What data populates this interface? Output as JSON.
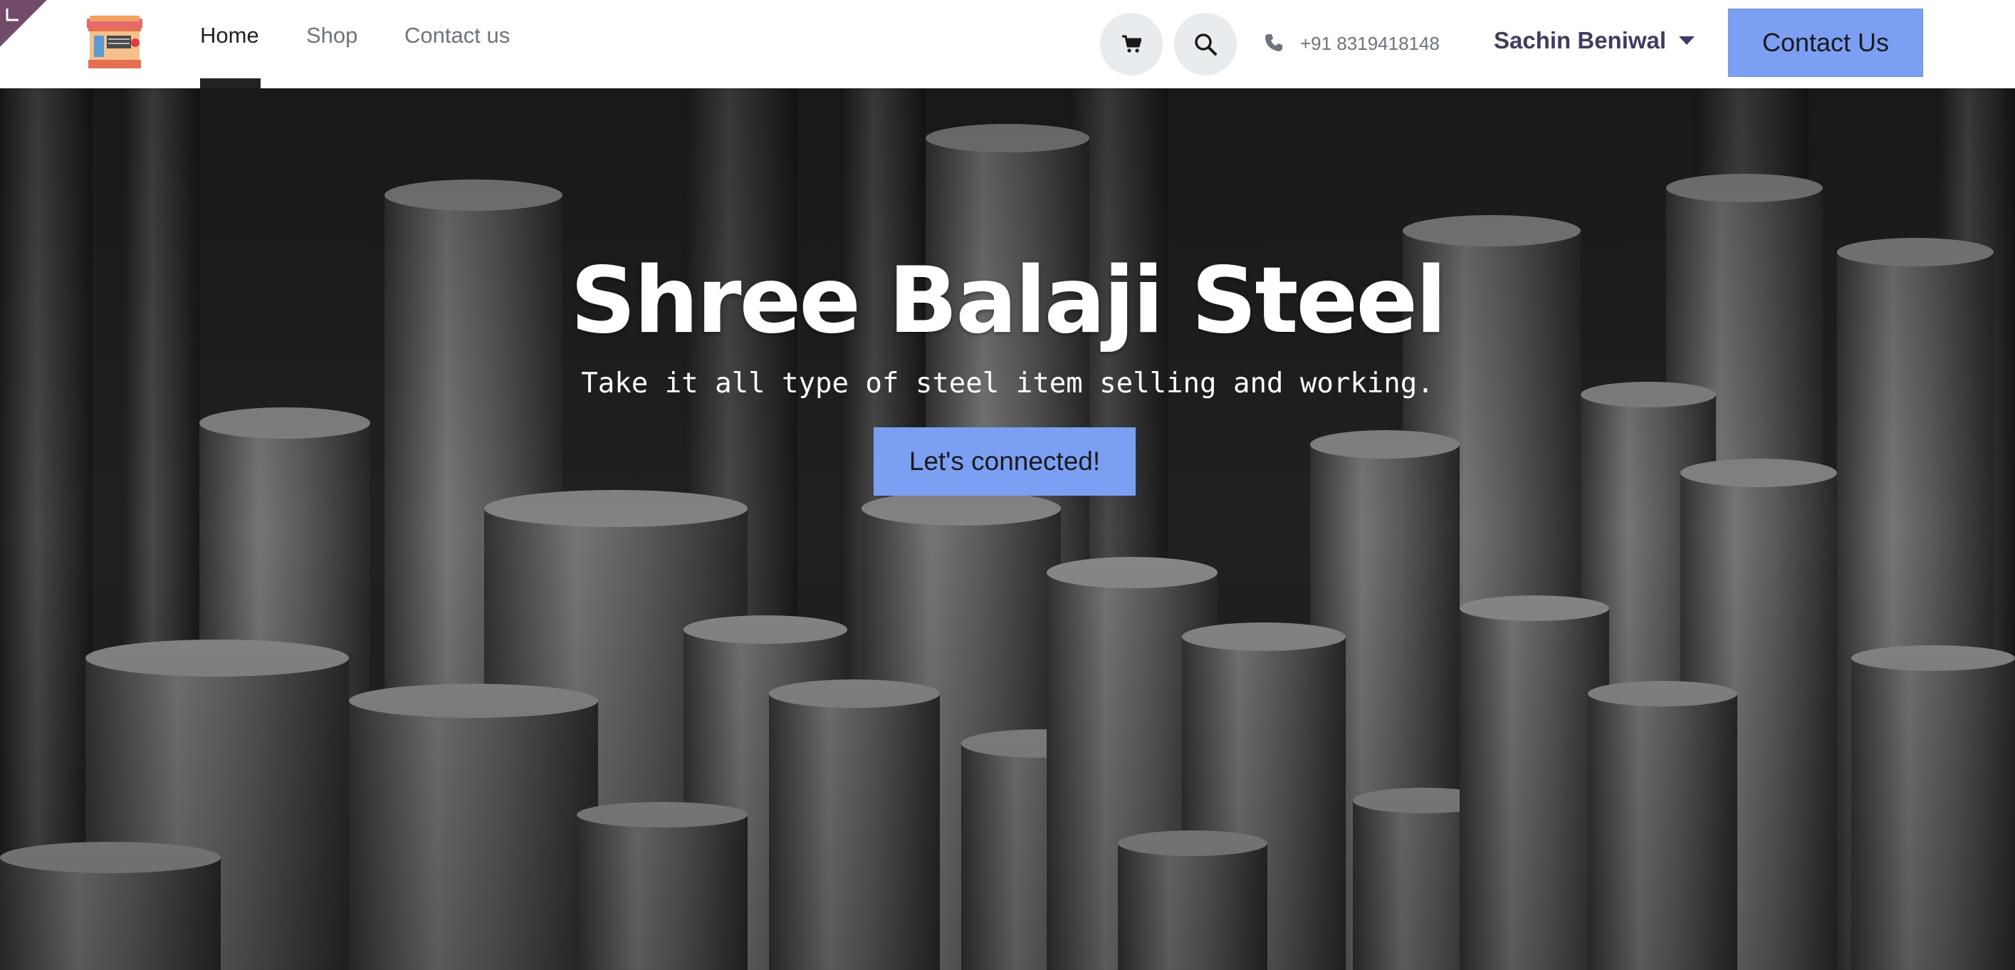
{
  "nav": {
    "items": [
      {
        "label": "Home"
      },
      {
        "label": "Shop"
      },
      {
        "label": "Contact us"
      }
    ],
    "phone": "+91 8319418148",
    "user_name": "Sachin Beniwal",
    "cta_label": "Contact Us"
  },
  "hero": {
    "title": "Shree Balaji Steel",
    "subtitle": "Take it all type of steel item selling and working.",
    "cta_label": "Let's connected!"
  },
  "icons": {
    "logo": "shop-store-icon",
    "cart": "shopping-cart-icon",
    "search": "search-icon",
    "phone": "phone-icon",
    "dropdown": "chevron-down-icon",
    "editor_corner": "editor-corner-icon"
  },
  "colors": {
    "accent": "#7a9ff3",
    "active_nav": "#222222",
    "user_name": "#3d3d63",
    "corner_badge": "#714b67"
  }
}
